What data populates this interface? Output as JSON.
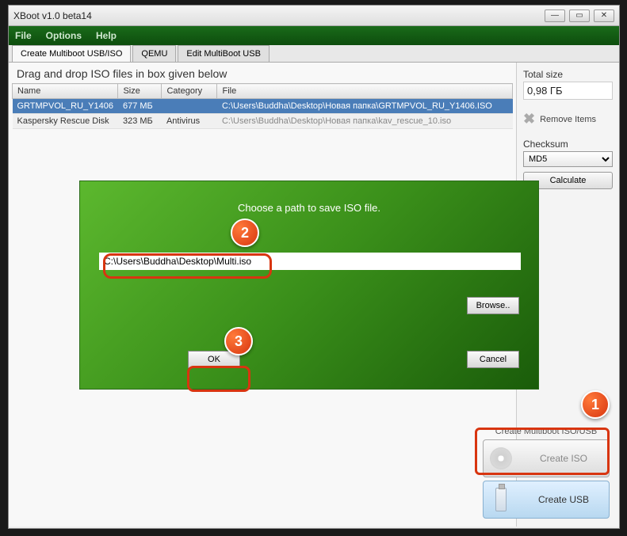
{
  "window": {
    "title": "XBoot v1.0 beta14"
  },
  "menu": {
    "file": "File",
    "options": "Options",
    "help": "Help"
  },
  "tabs": {
    "create": "Create Multiboot USB/ISO",
    "qemu": "QEMU",
    "edit": "Edit MultiBoot USB"
  },
  "main": {
    "subtitle": "Drag and drop ISO files in box given below",
    "headers": {
      "name": "Name",
      "size": "Size",
      "category": "Category",
      "file": "File"
    },
    "rows": [
      {
        "name": "GRTMPVOL_RU_Y1406",
        "size": "677 МБ",
        "category": "",
        "file": "C:\\Users\\Buddha\\Desktop\\Новая папка\\GRTMPVOL_RU_Y1406.ISO"
      },
      {
        "name": "Kaspersky Rescue Disk",
        "size": "323 МБ",
        "category": "Antivirus",
        "file": "C:\\Users\\Buddha\\Desktop\\Новая папка\\kav_rescue_10.iso"
      }
    ]
  },
  "sidebar": {
    "total_label": "Total size",
    "total_value": "0,98 ГБ",
    "remove": "Remove Items",
    "checksum_label": "Checksum",
    "checksum_value": "MD5",
    "calculate": "Calculate"
  },
  "bottom": {
    "label": "Create Multiboot ISO/USB",
    "iso": "Create ISO",
    "usb": "Create USB"
  },
  "dialog": {
    "title": "Choose a path to save ISO file.",
    "path": "C:\\Users\\Buddha\\Desktop\\Multi.iso",
    "browse": "Browse..",
    "ok": "OK",
    "cancel": "Cancel"
  },
  "markers": {
    "m1": "1",
    "m2": "2",
    "m3": "3"
  }
}
